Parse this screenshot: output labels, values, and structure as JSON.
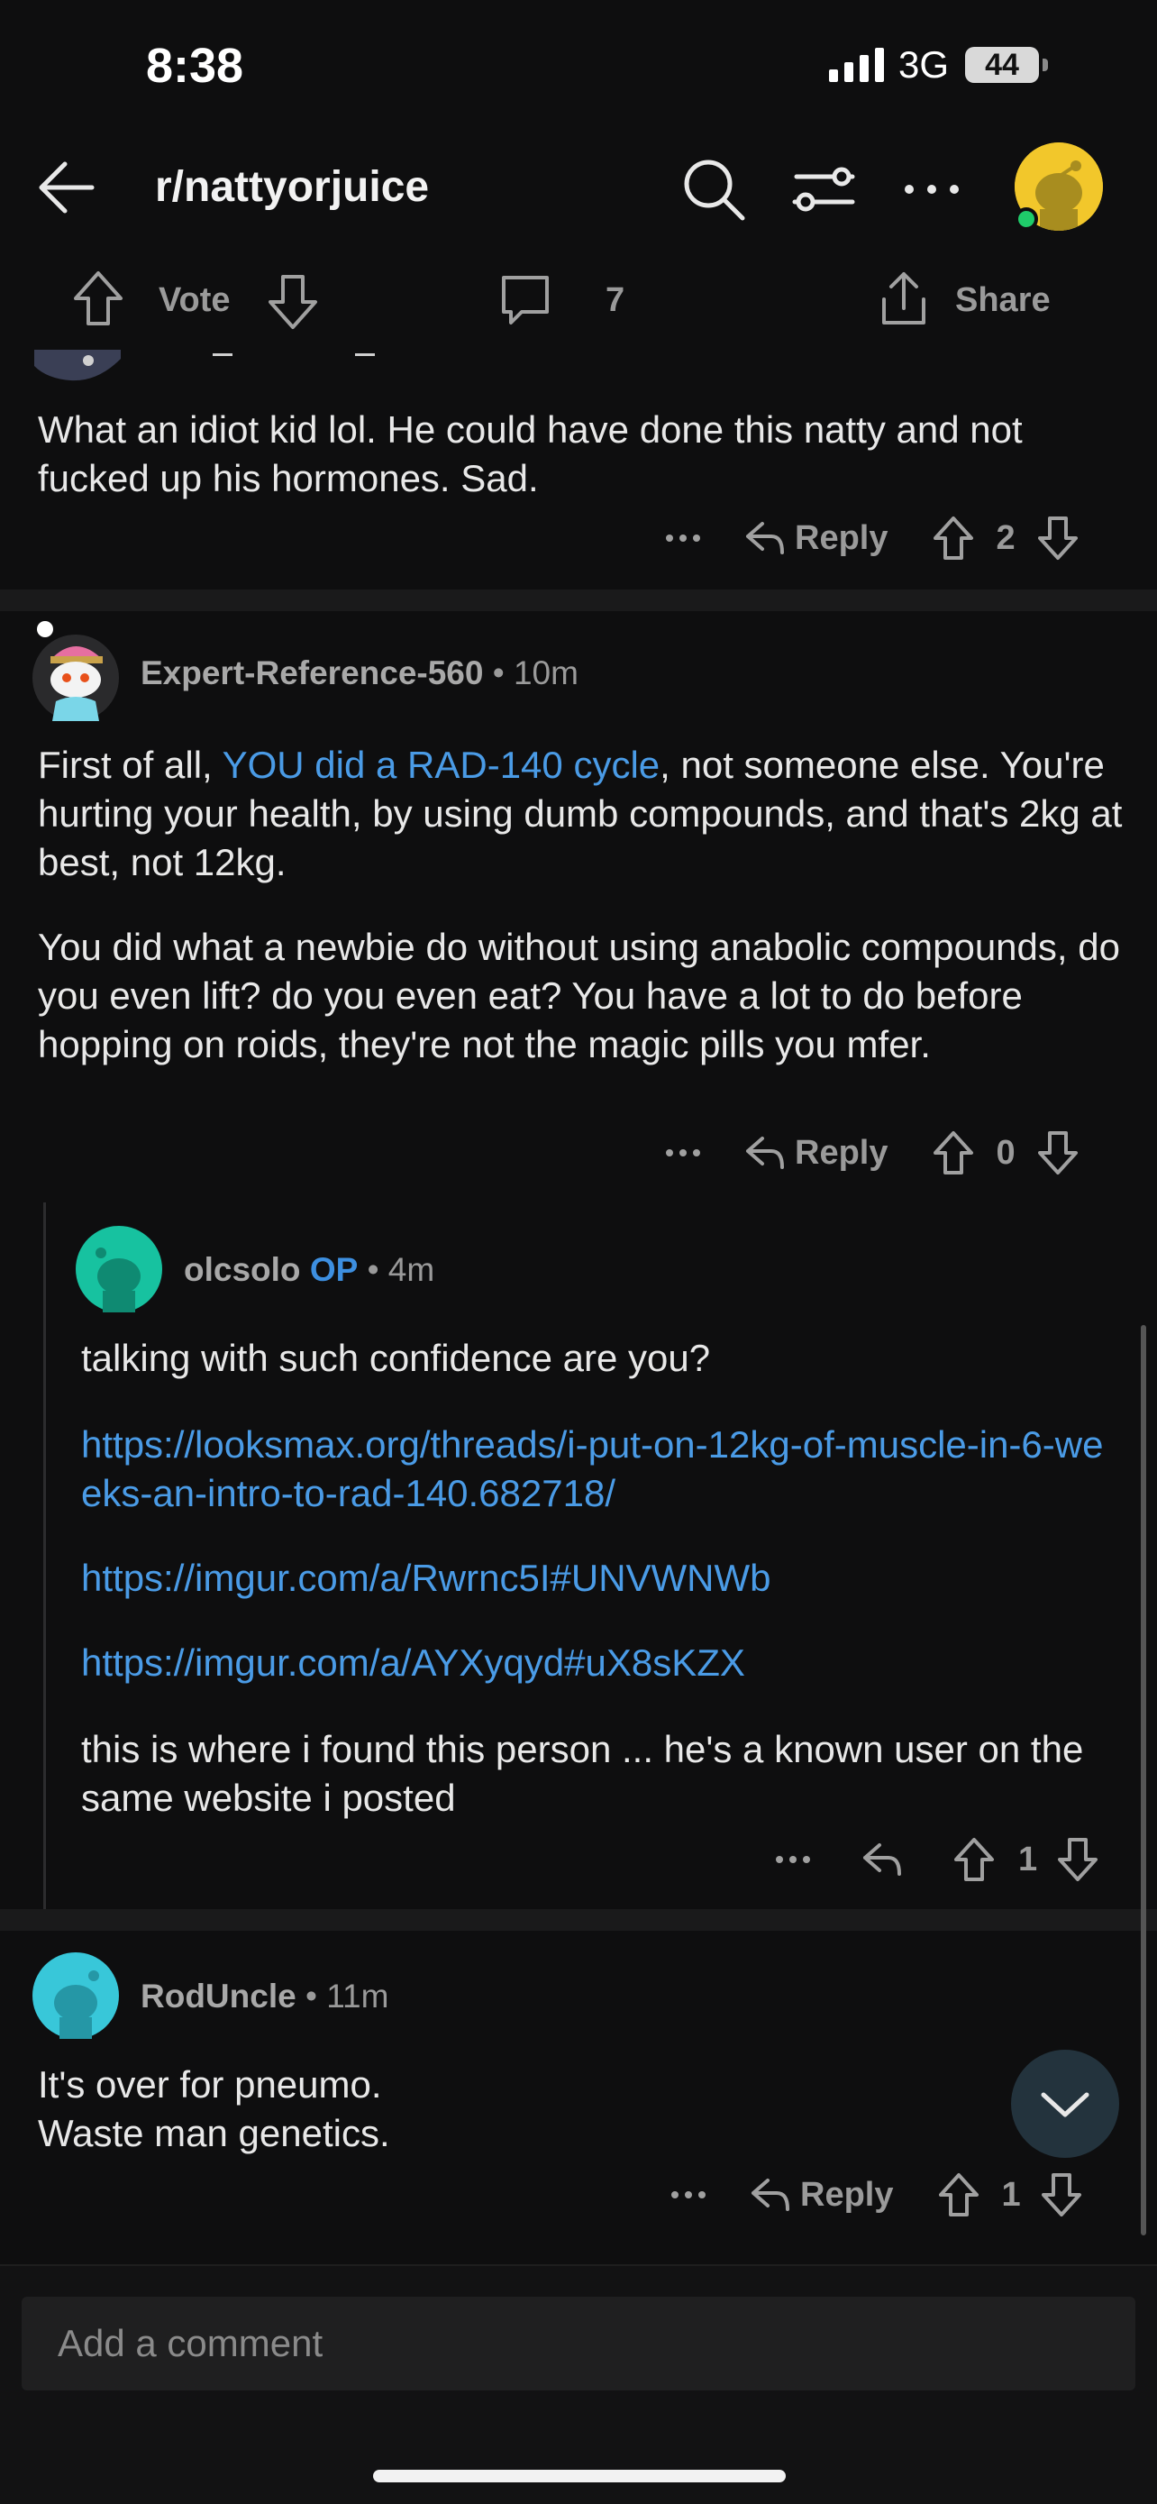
{
  "status": {
    "time": "8:38",
    "network": "3G",
    "battery": "44"
  },
  "header": {
    "subreddit": "r/nattyorjuice"
  },
  "post_bar": {
    "vote_label": "Vote",
    "comment_count": "7",
    "share_label": "Share"
  },
  "comments": [
    {
      "body": "What an idiot kid lol. He could have done this natty and not fucked up his hormones. Sad.",
      "reply_label": "Reply",
      "score": "2"
    },
    {
      "username": "Expert-Reference-560",
      "time": "10m",
      "body_p1_prefix": "First of all, ",
      "body_p1_link": "YOU did a RAD-140 cycle",
      "body_p1_suffix": ", not someone else. You're hurting your health, by using dumb compounds, and that's 2kg at best, not 12kg.",
      "body_p2": "You did what a newbie do without using anabolic compounds, do you even lift? do you even eat? You have a lot to do before hopping on roids, they're not the magic pills you mfer.",
      "reply_label": "Reply",
      "score": "0"
    },
    {
      "username": "olcsolo",
      "op_badge": "OP",
      "time": "4m",
      "body_p1": "talking with such confidence are you?",
      "link1": "https://looksmax.org/threads/i-put-on-12kg-of-muscle-in-6-weeks-an-intro-to-rad-140.682718/",
      "link2": "https://imgur.com/a/Rwrnc5I#UNVWNWb",
      "link3": "https://imgur.com/a/AYXyqyd#uX8sKZX",
      "body_p2": "this is where i found this person ... he's a known user on the same website i posted",
      "score": "1"
    },
    {
      "username": "RodUncle",
      "time": "11m",
      "body_line1": "It's over for pneumo.",
      "body_line2": "Waste man genetics.",
      "reply_label": "Reply",
      "score": "1"
    }
  ],
  "composer": {
    "placeholder": "Add a comment"
  },
  "colors": {
    "background": "#0e0e0f",
    "link": "#4a9be6",
    "op_badge": "#3d8fe0",
    "online": "#1fcc6a"
  }
}
